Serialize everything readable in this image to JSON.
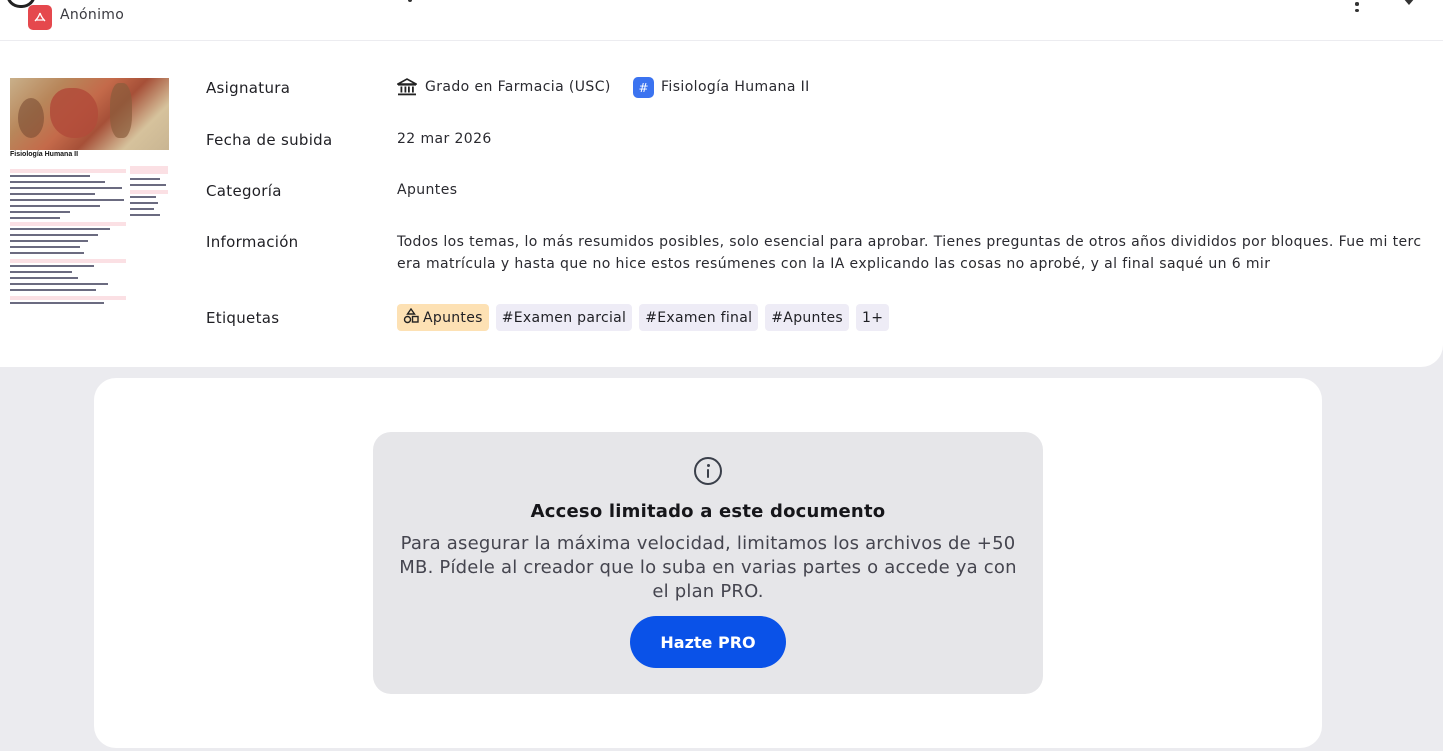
{
  "header": {
    "author": "Anónimo",
    "file_icon": "pdf-icon"
  },
  "thumbnail": {
    "title": "Fisiología Humana II"
  },
  "details": {
    "subject_label": "Asignatura",
    "university": "Grado en Farmacia (USC)",
    "subject": "Fisiología Humana II",
    "date_label": "Fecha de subida",
    "date": "22 mar 2026",
    "category_label": "Categoría",
    "category": "Apuntes",
    "info_label": "Información",
    "info": "Todos los temas, lo más resumidos posibles, solo esencial para aprobar. Tienes preguntas de otros años divididos por bloques. Fue mi tercera matrícula y hasta que no hice estos resúmenes con la IA explicando las cosas no aprobé, y al final saqué un 6 mir",
    "tags_label": "Etiquetas",
    "tags": [
      "Apuntes",
      "#Examen parcial",
      "#Examen final",
      "#Apuntes",
      "1+"
    ]
  },
  "notice": {
    "title": "Acceso limitado a este documento",
    "text": "Para asegurar la máxima velocidad, limitamos los archivos de +50 MB. Pídele al creador que lo suba en varias partes o accede ya con el plan PRO.",
    "button": "Hazte PRO"
  },
  "colors": {
    "accent": "#0a52e8",
    "subject_icon": "#3b73f0",
    "category_tag": "#fde1b4",
    "pdf_icon": "#e5484d"
  }
}
